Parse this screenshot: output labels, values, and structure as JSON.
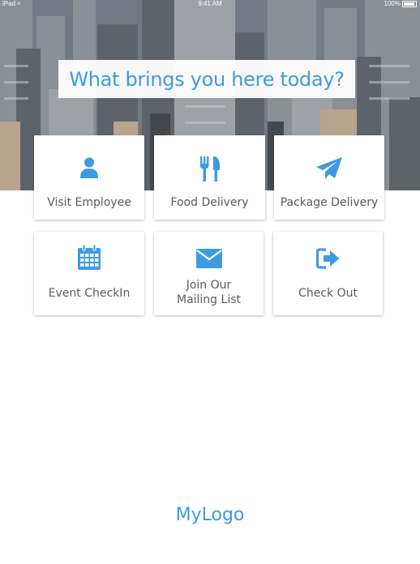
{
  "status_bar": {
    "carrier": "iPad",
    "time": "9:41 AM",
    "battery": "100%"
  },
  "hero": {
    "prompt": "What brings you here today?"
  },
  "tiles": [
    {
      "label": "Visit Employee",
      "icon": "person-icon"
    },
    {
      "label": "Food Delivery",
      "icon": "fork-knife-icon"
    },
    {
      "label": "Package Delivery",
      "icon": "paper-plane-icon"
    },
    {
      "label": "Event CheckIn",
      "icon": "calendar-icon"
    },
    {
      "label": "Join Our Mailing List",
      "label_line1": "Join Our",
      "label_line2": "Mailing List",
      "icon": "envelope-icon"
    },
    {
      "label": "Check Out",
      "icon": "sign-out-icon"
    }
  ],
  "footer": {
    "logo": "MyLogo"
  },
  "colors": {
    "accent": "#3d9be3",
    "tile_text": "#5a5a5a",
    "background": "#ffffff"
  }
}
